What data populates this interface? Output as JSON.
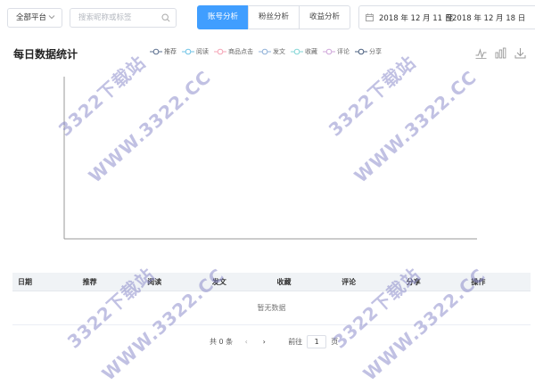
{
  "toolbar": {
    "platform_select": "全部平台",
    "search_placeholder": "搜索昵称或标签",
    "tabs": [
      {
        "label": "账号分析",
        "active": true
      },
      {
        "label": "粉丝分析",
        "active": false
      },
      {
        "label": "收益分析",
        "active": false
      }
    ],
    "date_start": "2018 年 12 月 11 日",
    "date_sep": "至",
    "date_end": "2018 年 12 月 18 日"
  },
  "section": {
    "title": "每日数据统计",
    "legend": [
      {
        "label": "推荐",
        "color": "#5b6f8f"
      },
      {
        "label": "阅读",
        "color": "#6fc3e6"
      },
      {
        "label": "商品点击",
        "color": "#f5a3b5"
      },
      {
        "label": "发文",
        "color": "#8fb0d8"
      },
      {
        "label": "收藏",
        "color": "#82d6d6"
      },
      {
        "label": "评论",
        "color": "#cfa6da"
      },
      {
        "label": "分享",
        "color": "#4a5f7f"
      }
    ],
    "tools": [
      "line-chart-icon",
      "bar-chart-icon",
      "download-icon"
    ]
  },
  "table": {
    "columns": [
      "日期",
      "推荐",
      "阅读",
      "发文",
      "收藏",
      "评论",
      "分享",
      "操作"
    ],
    "empty_text": "暂无数据"
  },
  "pagination": {
    "total": "共 0 条",
    "goto_prefix": "前往",
    "page": "1",
    "goto_suffix": "页"
  },
  "watermark": {
    "text": "3322下载站",
    "url": "WWW.3322.CC"
  }
}
